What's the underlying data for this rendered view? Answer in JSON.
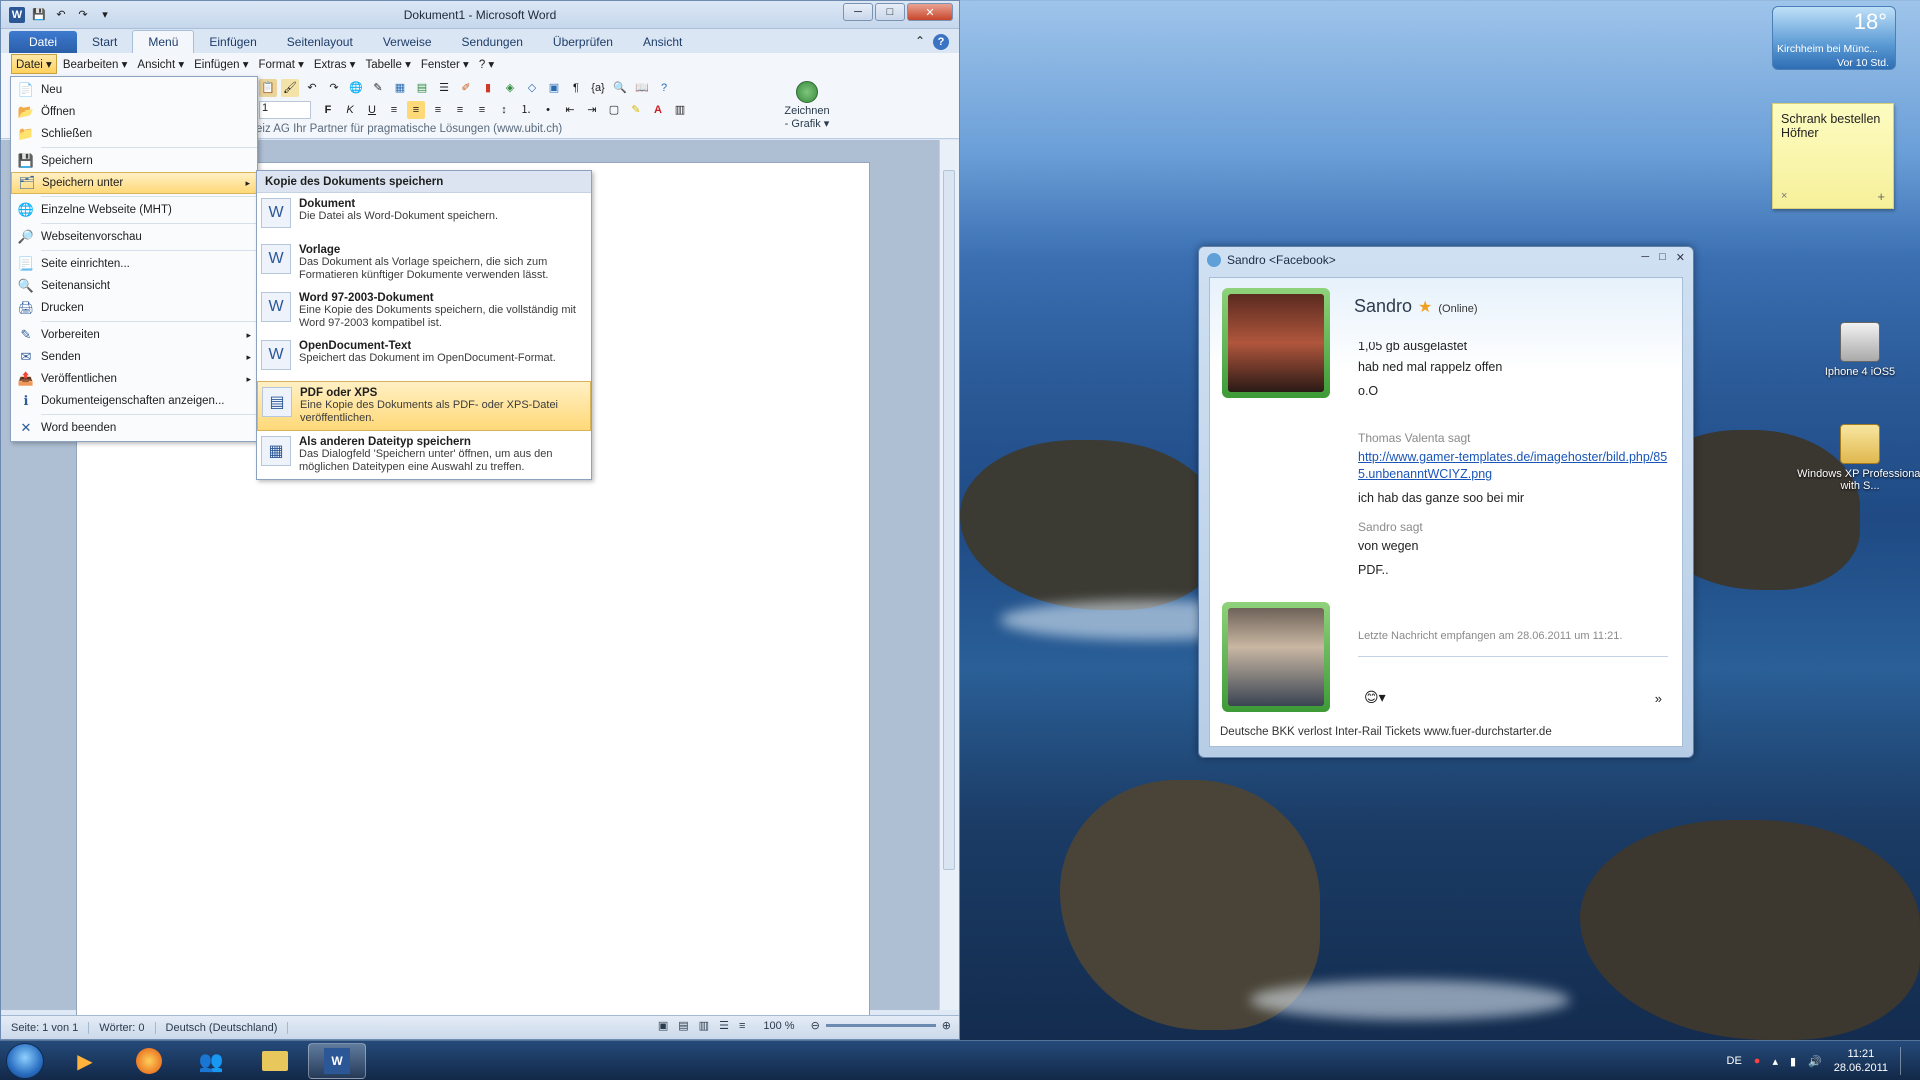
{
  "word": {
    "title": "Dokument1 - Microsoft Word",
    "tabs": [
      "Datei",
      "Start",
      "Menü",
      "Einfügen",
      "Seitenlayout",
      "Verweise",
      "Sendungen",
      "Überprüfen",
      "Ansicht"
    ],
    "menubar": [
      "Datei ▾",
      "Bearbeiten ▾",
      "Ansicht ▾",
      "Einfügen ▾",
      "Format ▾",
      "Extras ▾",
      "Tabelle ▾",
      "Fenster ▾",
      "? ▾"
    ],
    "font_size": "1",
    "partner_text": "eiz AG   Ihr Partner für pragmatische Lösungen   (www.ubit.ch)",
    "draw_label": "Zeichnen - Grafik ▾",
    "status": {
      "page": "Seite: 1 von 1",
      "words": "Wörter: 0",
      "lang": "Deutsch (Deutschland)",
      "zoom": "100 %"
    }
  },
  "file_menu": {
    "items": [
      {
        "label": "Neu",
        "icon": "new-doc-icon"
      },
      {
        "label": "Öffnen",
        "icon": "open-folder-icon"
      },
      {
        "label": "Schließen",
        "icon": "close-folder-icon"
      },
      {
        "label": "Speichern",
        "icon": "save-icon"
      },
      {
        "label": "Speichern unter",
        "icon": "save-as-icon",
        "submenu": true,
        "selected": true
      },
      {
        "label": "Einzelne Webseite (MHT)",
        "icon": "web-page-icon"
      },
      {
        "label": "Webseitenvorschau",
        "icon": "web-preview-icon"
      },
      {
        "label": "Seite einrichten...",
        "icon": "page-setup-icon"
      },
      {
        "label": "Seitenansicht",
        "icon": "print-preview-icon"
      },
      {
        "label": "Drucken",
        "icon": "print-icon"
      },
      {
        "label": "Vorbereiten",
        "icon": "prepare-icon",
        "submenu": true
      },
      {
        "label": "Senden",
        "icon": "send-icon",
        "submenu": true
      },
      {
        "label": "Veröffentlichen",
        "icon": "publish-icon",
        "submenu": true
      },
      {
        "label": "Dokumenteigenschaften anzeigen...",
        "icon": "properties-icon"
      },
      {
        "label": "Word beenden",
        "icon": "exit-icon"
      }
    ]
  },
  "save_as_menu": {
    "header": "Kopie des Dokuments speichern",
    "items": [
      {
        "title": "Dokument",
        "desc": "Die Datei als Word-Dokument speichern."
      },
      {
        "title": "Vorlage",
        "desc": "Das Dokument als Vorlage speichern, die sich zum Formatieren künftiger Dokumente verwenden lässt."
      },
      {
        "title": "Word 97-2003-Dokument",
        "desc": "Eine Kopie des Dokuments speichern, die vollständig mit Word 97-2003 kompatibel ist."
      },
      {
        "title": "OpenDocument-Text",
        "desc": "Speichert das Dokument im OpenDocument-Format."
      },
      {
        "title": "PDF oder XPS",
        "desc": "Eine Kopie des Dokuments als PDF- oder XPS-Datei veröffentlichen.",
        "selected": true
      },
      {
        "title": "Als anderen Dateityp speichern",
        "desc": "Das Dialogfeld 'Speichern unter' öffnen, um aus den möglichen Dateitypen eine Auswahl zu treffen."
      }
    ]
  },
  "weather": {
    "temp": "18°",
    "location": "Kirchheim bei Münc...",
    "ago": "Vor 10 Std."
  },
  "sticky_note": {
    "text": "Schrank bestellen Höfner",
    "close": "×",
    "add": "+"
  },
  "desktop_icons": [
    {
      "label": "Iphone 4 iOS5"
    },
    {
      "label": "Windows XP Professional with S..."
    }
  ],
  "chat": {
    "title": "Sandro <Facebook>",
    "name": "Sandro",
    "status": "(Online)",
    "messages_top": [
      "1,05 gb ausgelastet",
      "hab ned mal rappelz offen",
      "o.O"
    ],
    "sender1": "Thomas Valenta sagt",
    "link": "http://www.gamer-templates.de/imagehoster/bild.php/855.unbenanntWCIYZ.png",
    "msg1": "ich hab das ganze soo bei mir",
    "sender2": "Sandro sagt",
    "msg2a": "von wegen",
    "msg2b": "PDF..",
    "last": "Letzte Nachricht empfangen am 28.06.2011 um 11:21.",
    "ad": "Deutsche BKK verlost Inter-Rail Tickets www.fuer-durchstarter.de"
  },
  "taskbar": {
    "lang": "DE",
    "time": "11:21",
    "date": "28.06.2011"
  },
  "colors": {
    "accent": "#2b5797",
    "selection": "#ffd978",
    "chat_frame": "#3d9a36"
  }
}
